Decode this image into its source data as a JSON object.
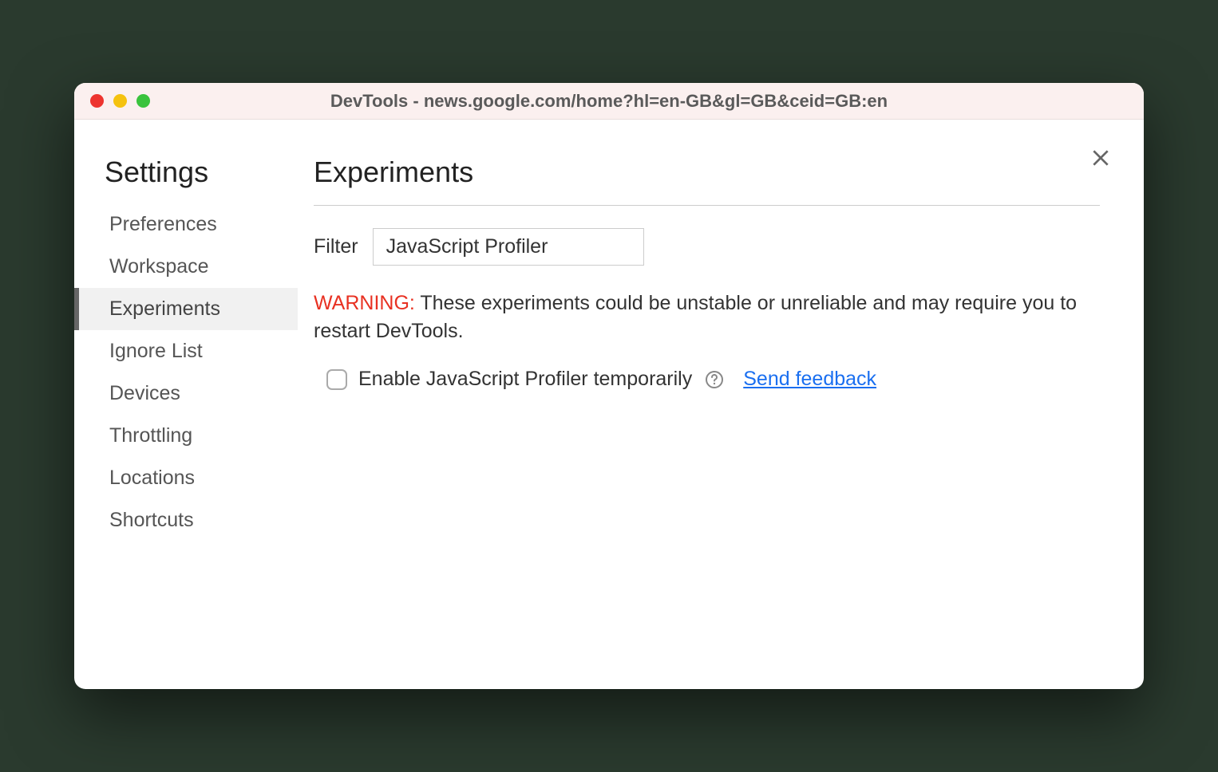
{
  "window": {
    "title": "DevTools - news.google.com/home?hl=en-GB&gl=GB&ceid=GB:en"
  },
  "sidebar": {
    "title": "Settings",
    "items": [
      {
        "label": "Preferences",
        "selected": false
      },
      {
        "label": "Workspace",
        "selected": false
      },
      {
        "label": "Experiments",
        "selected": true
      },
      {
        "label": "Ignore List",
        "selected": false
      },
      {
        "label": "Devices",
        "selected": false
      },
      {
        "label": "Throttling",
        "selected": false
      },
      {
        "label": "Locations",
        "selected": false
      },
      {
        "label": "Shortcuts",
        "selected": false
      }
    ]
  },
  "main": {
    "title": "Experiments",
    "filter": {
      "label": "Filter",
      "value": "JavaScript Profiler"
    },
    "warning": {
      "prefix": "WARNING:",
      "text": " These experiments could be unstable or unreliable and may require you to restart DevTools."
    },
    "experiment": {
      "checked": false,
      "label": "Enable JavaScript Profiler temporarily",
      "feedback_link": "Send feedback"
    }
  }
}
